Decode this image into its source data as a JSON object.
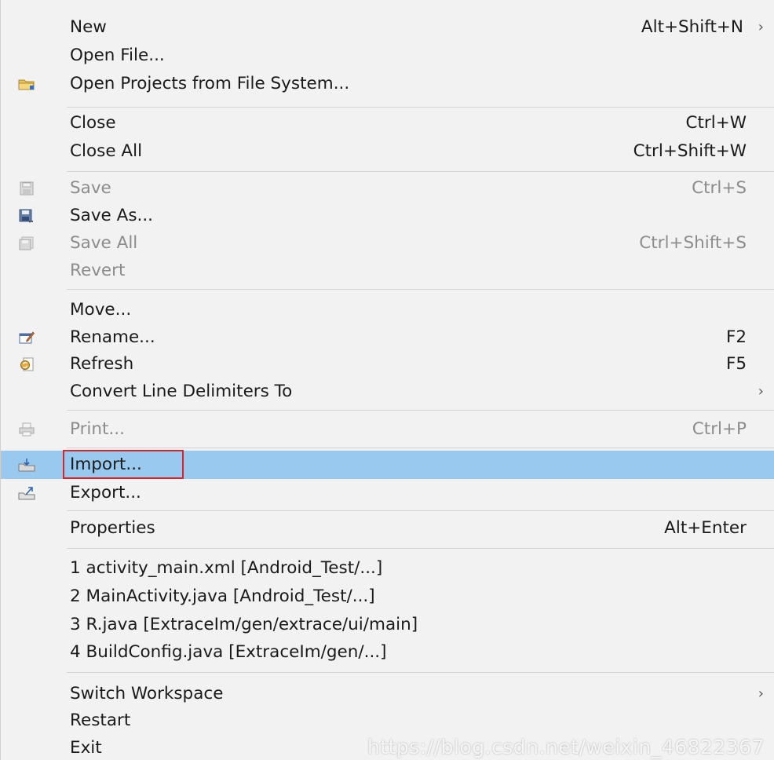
{
  "menu": {
    "items": [
      {
        "id": "new",
        "label": "New",
        "shortcut": "Alt+Shift+N",
        "arrow": "›"
      },
      {
        "id": "open-file",
        "label": "Open File..."
      },
      {
        "id": "open-projects",
        "label": "Open Projects from File System...",
        "icon": "folder-icon"
      },
      {
        "id": "close",
        "label": "Close",
        "shortcut": "Ctrl+W"
      },
      {
        "id": "close-all",
        "label": "Close All",
        "shortcut": "Ctrl+Shift+W"
      },
      {
        "id": "save",
        "label": "Save",
        "shortcut": "Ctrl+S",
        "icon": "save-icon",
        "disabled": true
      },
      {
        "id": "save-as",
        "label": "Save As...",
        "icon": "save-as-icon"
      },
      {
        "id": "save-all",
        "label": "Save All",
        "shortcut": "Ctrl+Shift+S",
        "icon": "save-all-icon",
        "disabled": true
      },
      {
        "id": "revert",
        "label": "Revert",
        "disabled": true
      },
      {
        "id": "move",
        "label": "Move..."
      },
      {
        "id": "rename",
        "label": "Rename...",
        "shortcut": "F2",
        "icon": "rename-icon"
      },
      {
        "id": "refresh",
        "label": "Refresh",
        "shortcut": "F5",
        "icon": "refresh-icon"
      },
      {
        "id": "convert",
        "label": "Convert Line Delimiters To",
        "arrow": "›"
      },
      {
        "id": "print",
        "label": "Print...",
        "shortcut": "Ctrl+P",
        "icon": "print-icon",
        "disabled": true
      },
      {
        "id": "import",
        "label": "Import...",
        "icon": "import-icon",
        "highlight": true
      },
      {
        "id": "export",
        "label": "Export...",
        "icon": "export-icon"
      },
      {
        "id": "properties",
        "label": "Properties",
        "shortcut": "Alt+Enter"
      },
      {
        "id": "recent-1",
        "label": "1 activity_main.xml  [Android_Test/...]"
      },
      {
        "id": "recent-2",
        "label": "2 MainActivity.java  [Android_Test/...]"
      },
      {
        "id": "recent-3",
        "label": "3 R.java  [ExtraceIm/gen/extrace/ui/main]"
      },
      {
        "id": "recent-4",
        "label": "4 BuildConfig.java  [ExtraceIm/gen/...]"
      },
      {
        "id": "switch-workspace",
        "label": "Switch Workspace",
        "arrow": "›"
      },
      {
        "id": "restart",
        "label": "Restart"
      },
      {
        "id": "exit",
        "label": "Exit"
      }
    ]
  },
  "watermark": "https://blog.csdn.net/weixin_46822367",
  "colors": {
    "background": "#f2f2f2",
    "highlight": "#99c9ef",
    "disabled_text": "#8c8c8c",
    "annotation_box": "#d9262c"
  }
}
